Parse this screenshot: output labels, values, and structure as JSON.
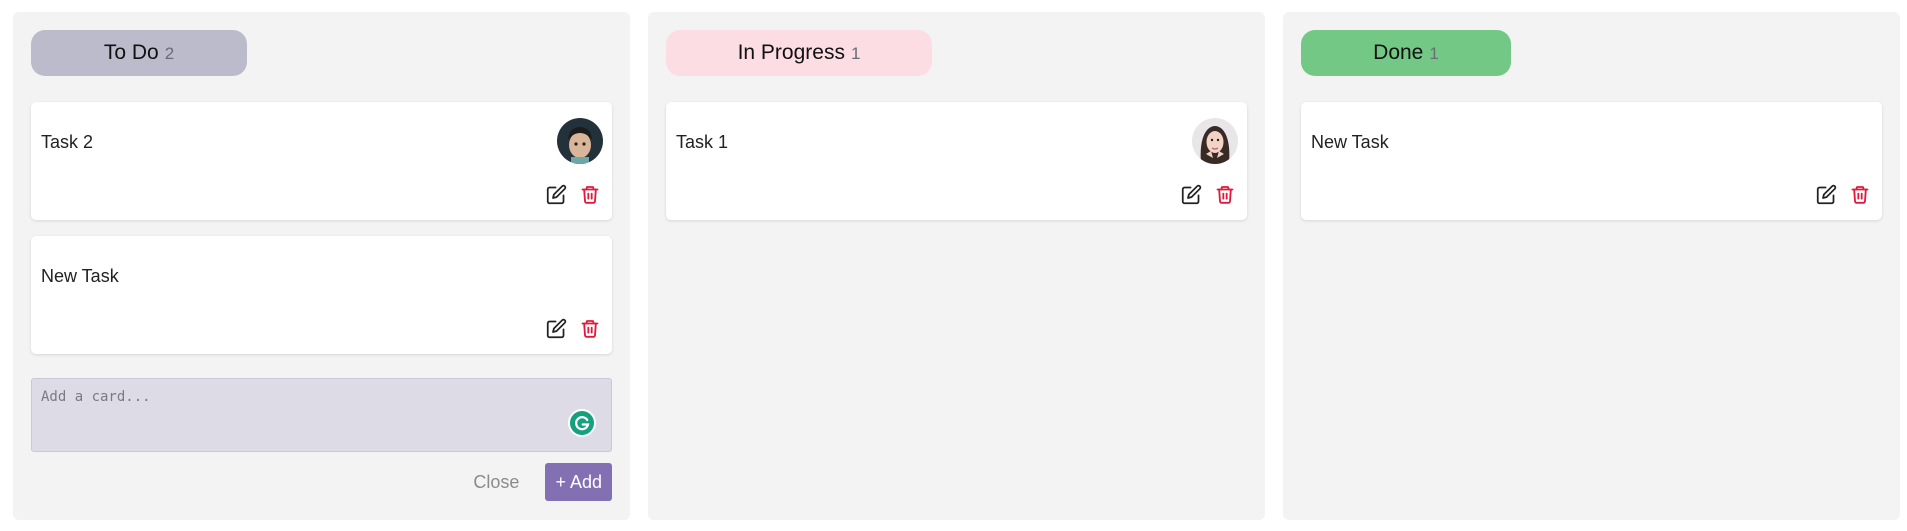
{
  "columns": [
    {
      "id": "todo",
      "title": "To Do",
      "count": "2",
      "header_color": "#bcbbcb",
      "header_width": "forecast",
      "cards": [
        {
          "title": "Task 2",
          "avatar": "child-avatar"
        },
        {
          "title": "New Task"
        }
      ]
    },
    {
      "id": "progress",
      "title": "In Progress",
      "count": "1",
      "header_color": "#fcdde3",
      "cards": [
        {
          "title": "Task 1",
          "avatar": "woman-avatar"
        }
      ]
    },
    {
      "id": "done",
      "title": "Done",
      "count": "1",
      "header_color": "#74c886",
      "cards": [
        {
          "title": "New Task"
        }
      ]
    }
  ],
  "add_card": {
    "placeholder": "Add a card...",
    "close_label": "Close",
    "add_label": "+ Add"
  },
  "colors": {
    "delete_icon": "#e0193c",
    "add_button": "#8370b3"
  }
}
